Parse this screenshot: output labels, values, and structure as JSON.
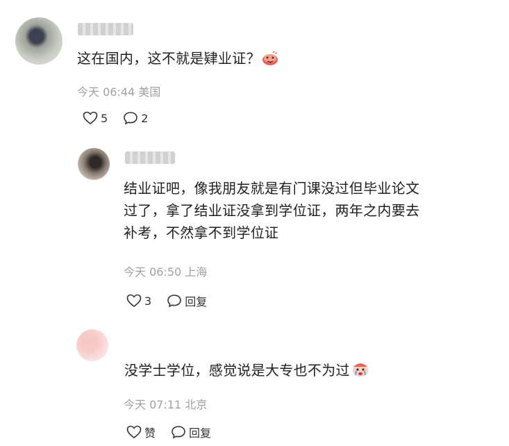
{
  "comments": [
    {
      "text": "这在国内，这不就是肄业证？",
      "emoji": "hot-face-emoji",
      "time": "今天 06:44",
      "location": "美国",
      "likes": "5",
      "replies": "2"
    },
    {
      "text_lines": [
        "结业证吧，像我朋友就是有门课没过但毕业论文",
        "过了，拿了结业证没拿到学位证，两年之内要去",
        "补考，不然拿不到学位证"
      ],
      "time": "今天 06:50",
      "location": "上海",
      "likes": "3",
      "reply_label": "回复"
    },
    {
      "text": "没学士学位，感觉说是大专也不为过",
      "emoji": "crying-clown-emoji",
      "time": "今天 07:11",
      "location": "北京",
      "like_label": "赞",
      "reply_label": "回复"
    }
  ]
}
